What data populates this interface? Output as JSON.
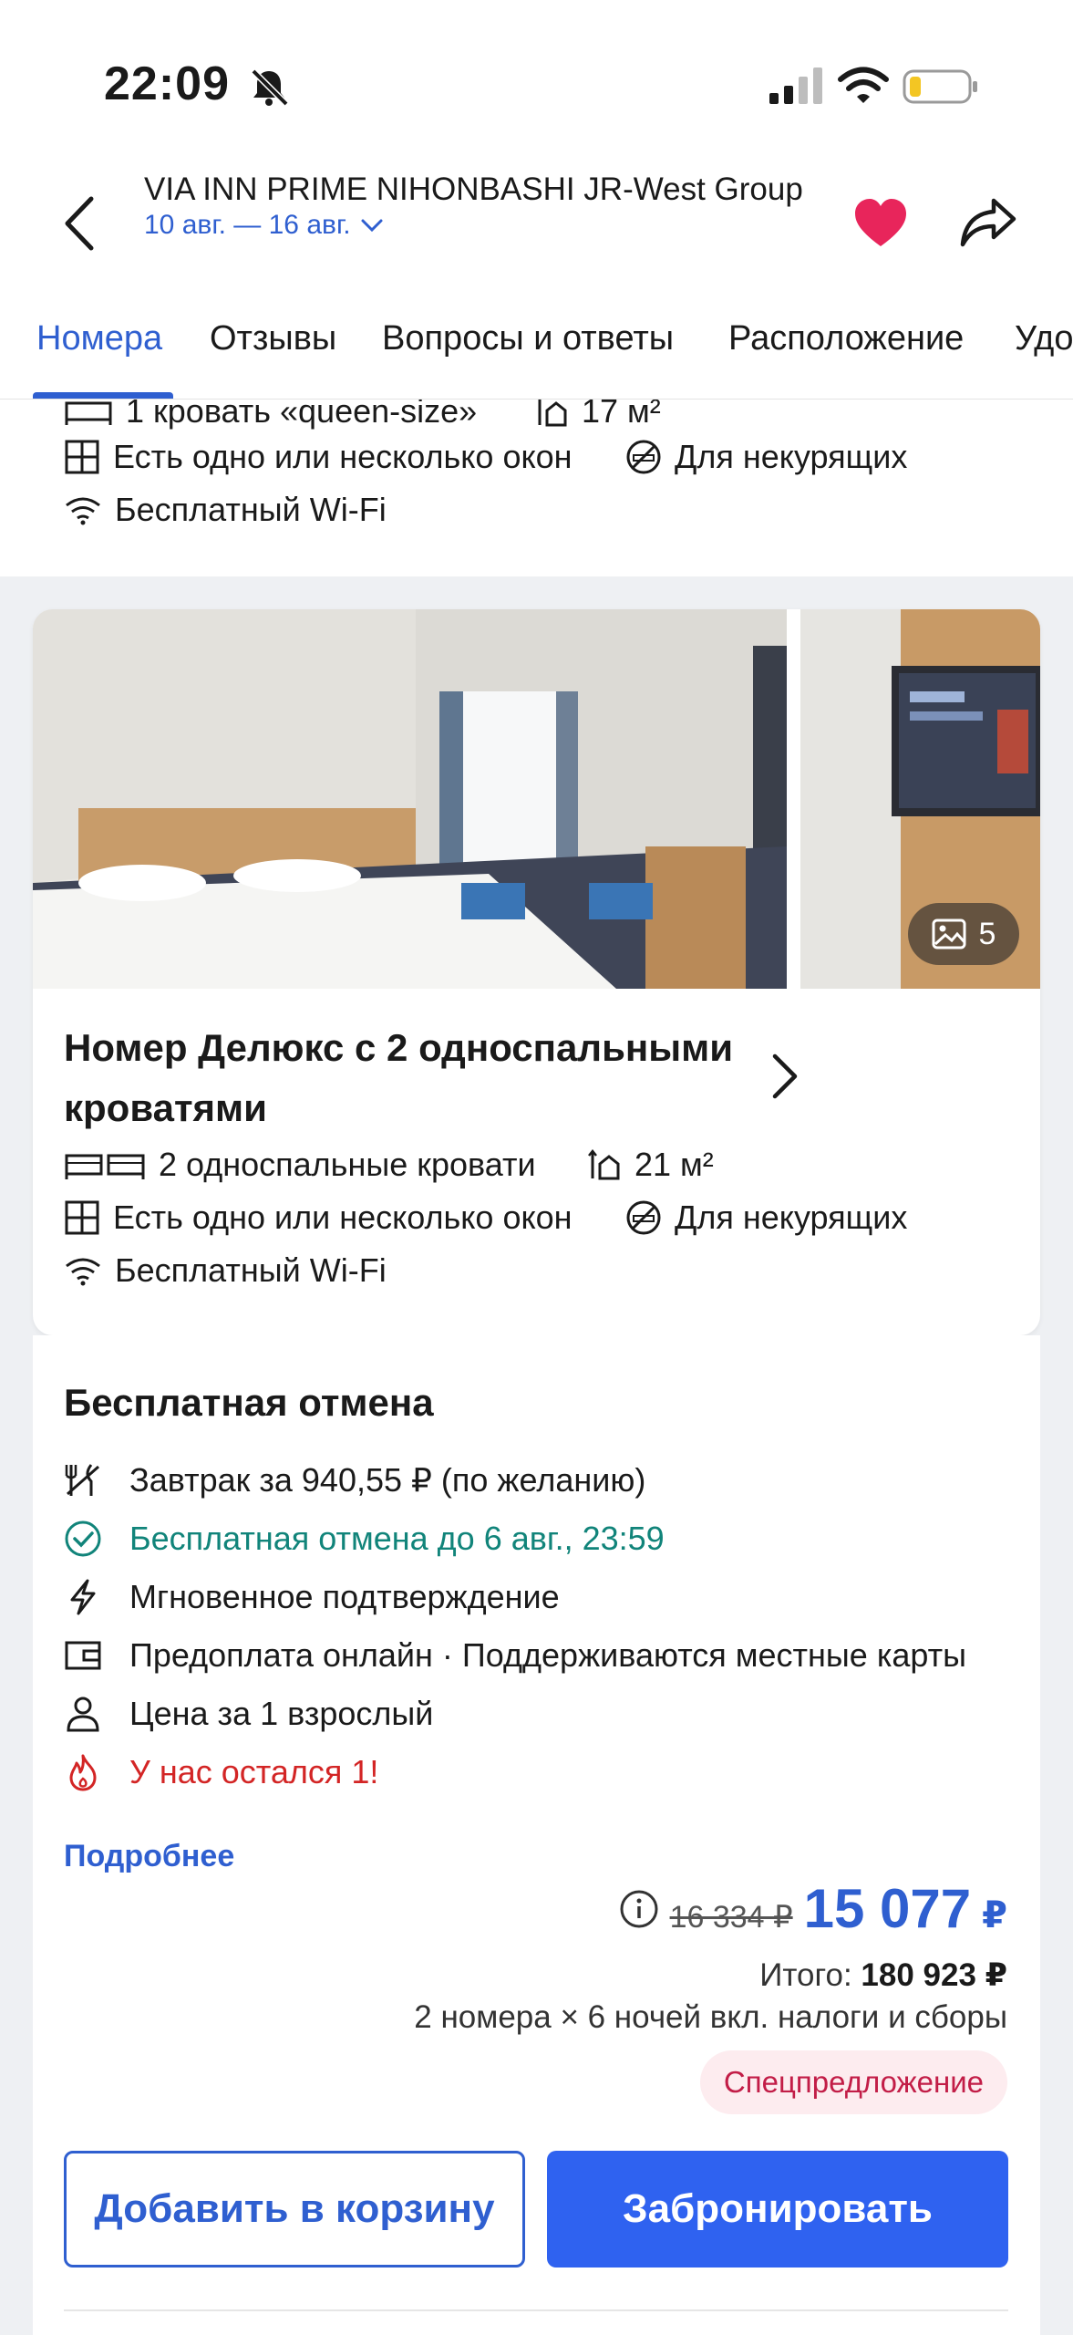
{
  "status_bar": {
    "time": "22:09"
  },
  "header": {
    "hotel_name": "VIA INN PRIME NIHONBASHI JR-West Group",
    "dates": "10 авг. — 16 авг.",
    "heart_color": "#e8255b"
  },
  "tabs": [
    "Номера",
    "Отзывы",
    "Вопросы и ответы",
    "Расположение",
    "Удо"
  ],
  "prev_room": {
    "bed": "1 кровать «queen-size»",
    "area": "17 м²",
    "windows": "Есть одно или несколько окон",
    "smoking": "Для некурящих",
    "wifi": "Бесплатный Wi-Fi"
  },
  "room": {
    "photo_count": "5",
    "title": "Номер Делюкс с 2 односпальными кроватями",
    "beds": "2 односпальные кровати",
    "area": "21 м²",
    "windows": "Есть одно или несколько окон",
    "smoking": "Для некурящих",
    "wifi": "Бесплатный Wi-Fi"
  },
  "offer": {
    "title": "Бесплатная отмена",
    "items": [
      {
        "icon": "utensils-icon",
        "text": "Завтрак за 940,55 ₽ (по желанию)"
      },
      {
        "icon": "check-circle-icon",
        "text": "Бесплатная отмена до 6 авг., 23:59"
      },
      {
        "icon": "lightning-icon",
        "text": "Мгновенное подтверждение"
      },
      {
        "icon": "wallet-icon",
        "text": "Предоплата онлайн · Поддерживаются местные карты"
      },
      {
        "icon": "person-icon",
        "text": "Цена за 1 взрослый"
      },
      {
        "icon": "fire-icon",
        "text": "У нас остался 1!"
      }
    ],
    "more_link": "Подробнее",
    "old_price": "16 334 ₽",
    "new_price": "15 077",
    "currency": "₽",
    "total_label": "Итого:",
    "total_value": "180 923 ₽",
    "nights": "2 номера × 6 ночей вкл. налоги и сборы",
    "badge": "Спецпредложение",
    "cart_button": "Добавить в корзину",
    "book_button": "Забронировать"
  },
  "colors": {
    "accent": "#2f5fd0",
    "green": "#11847a",
    "red": "#d32525",
    "badge_bg": "#fdecef"
  }
}
